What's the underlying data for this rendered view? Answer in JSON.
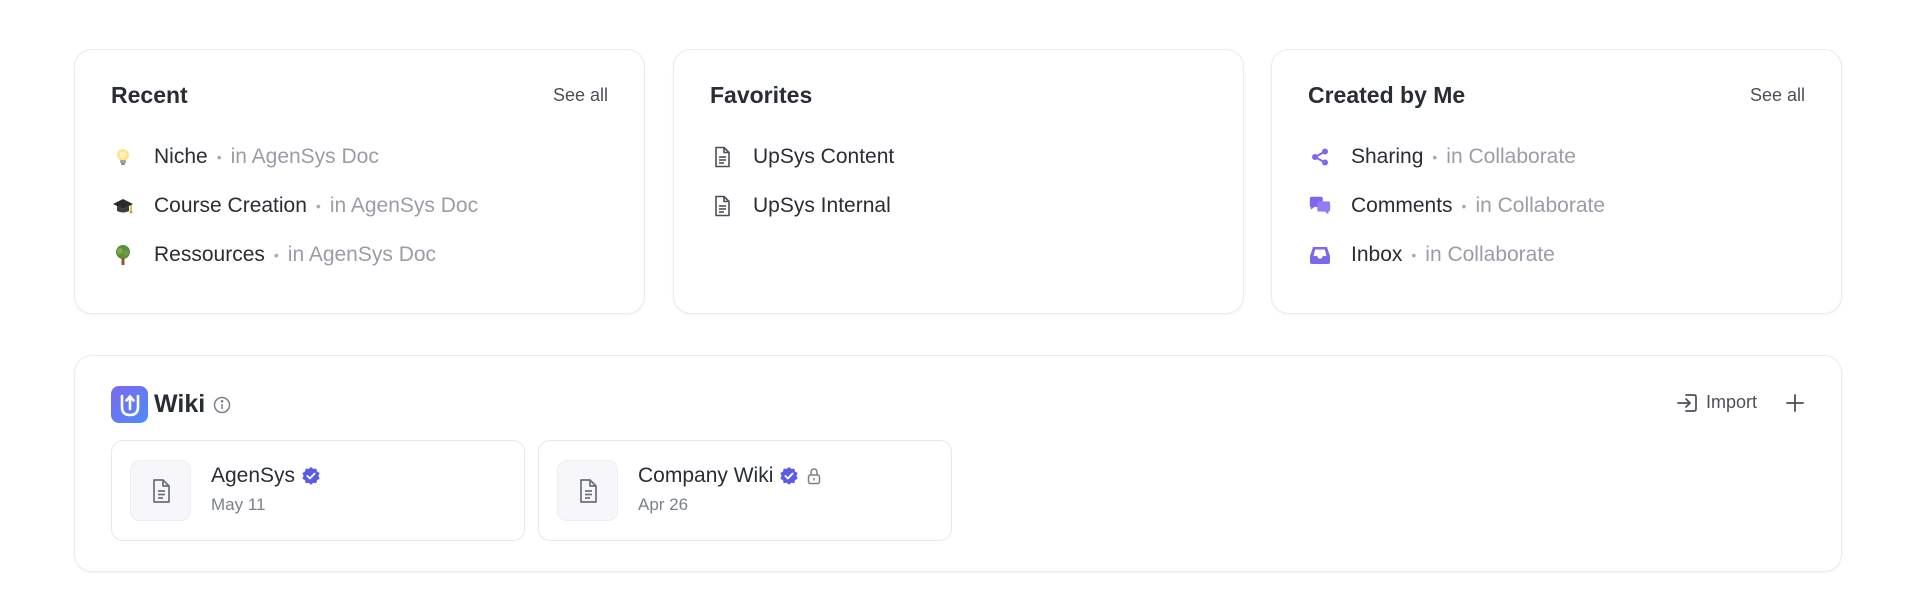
{
  "recent": {
    "title": "Recent",
    "see_all": "See all",
    "items": [
      {
        "icon": "lightbulb-icon",
        "name": "Niche",
        "location": "in AgenSys Doc"
      },
      {
        "icon": "graduation-cap-icon",
        "name": "Course Creation",
        "location": "in AgenSys Doc"
      },
      {
        "icon": "tree-icon",
        "name": "Ressources",
        "location": "in AgenSys Doc"
      }
    ]
  },
  "favorites": {
    "title": "Favorites",
    "items": [
      {
        "icon": "document-icon",
        "name": "UpSys Content"
      },
      {
        "icon": "document-icon",
        "name": "UpSys Internal"
      }
    ]
  },
  "created_by_me": {
    "title": "Created by Me",
    "see_all": "See all",
    "items": [
      {
        "icon": "share-icon",
        "name": "Sharing",
        "location": "in Collaborate"
      },
      {
        "icon": "comments-icon",
        "name": "Comments",
        "location": "in Collaborate"
      },
      {
        "icon": "inbox-icon",
        "name": "Inbox",
        "location": "in Collaborate"
      }
    ]
  },
  "wiki": {
    "title": "Wiki",
    "import_label": "Import",
    "docs": [
      {
        "name": "AgenSys",
        "date": "May 11",
        "verified": true,
        "locked": false
      },
      {
        "name": "Company Wiki",
        "date": "Apr 26",
        "verified": true,
        "locked": true
      }
    ]
  },
  "colors": {
    "accent": "#7b68ee",
    "text": "#292d34",
    "muted": "#9a9da6",
    "border": "#ececef"
  }
}
